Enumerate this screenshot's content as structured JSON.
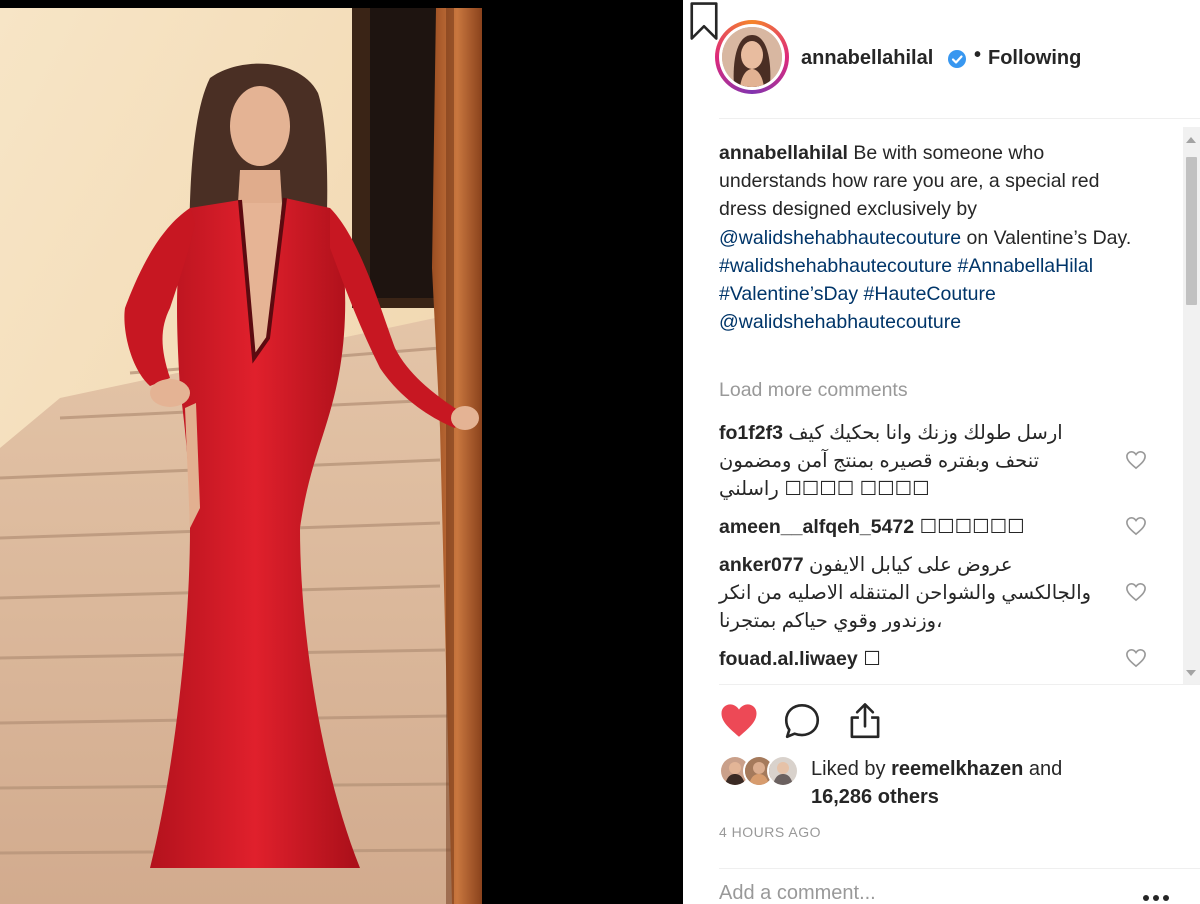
{
  "post": {
    "author": "annabellahilal",
    "verified": true,
    "separator": "•",
    "follow_status": "Following"
  },
  "caption": {
    "username": "annabellahilal",
    "text_1": "Be with someone who understands how rare you are, a special red dress designed exclusively by",
    "mention_1": "@walidshehabhautecouture",
    "text_2": "on Valentine’s Day.",
    "hashtag_1": "#walidshehabhautecouture",
    "hashtag_2": "#AnnabellaHilal",
    "hashtag_3": "#Valentine’sDay",
    "hashtag_4": "#HauteCouture",
    "mention_2": "@walidshehabhautecouture"
  },
  "load_more_label": "Load more comments",
  "comments": [
    {
      "user": "fo1f2f3",
      "text": "ارسل طولك وزنك وانا بحكيك كيف تنحف وبفتره قصيره بمنتج آمن ومضمون راسلني ☐☐☐☐ ☐☐☐☐"
    },
    {
      "user": "ameen__alfqeh_5472",
      "text": "☐☐☐☐☐☐"
    },
    {
      "user": "anker077",
      "text": "عروض على كيابل الايفون والجالكسي والشواحن المتنقله الاصليه من انكر وزندور وقوي حياكم بمتجرنا،"
    },
    {
      "user": "fouad.al.liwaey",
      "text": "☐"
    }
  ],
  "likes": {
    "prefix": "Liked by",
    "user": "reemelkhazen",
    "suffix": "and",
    "others": "16,286 others"
  },
  "timestamp": "4 HOURS AGO",
  "comment_box": {
    "placeholder": "Add a comment..."
  },
  "icons": {
    "verified": "verified-badge-icon",
    "like": "heart-filled-icon",
    "comment": "speech-bubble-icon",
    "share": "share-icon",
    "save": "bookmark-icon",
    "more": "more-options-icon"
  },
  "colors": {
    "like_red": "#ed4956",
    "verified_blue": "#3897f0",
    "link_blue": "#003569",
    "muted_gray": "#999999"
  }
}
